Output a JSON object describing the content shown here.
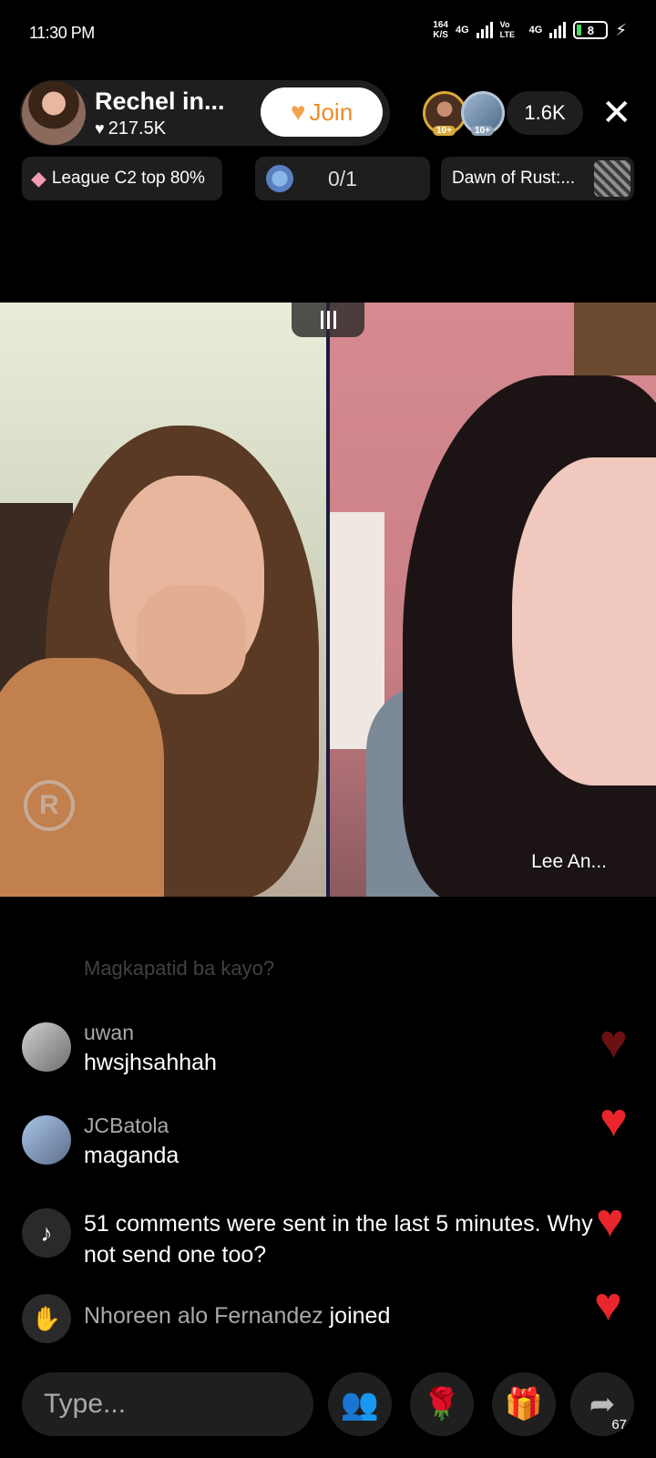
{
  "status_bar": {
    "time": "11:30 PM",
    "net_speed_value": "164",
    "net_speed_unit": "K/S",
    "network_1": "4G",
    "volte": "Vo LTE",
    "network_2": "4G",
    "battery": "8"
  },
  "host": {
    "name": "Rechel in...",
    "likes": "217.5K",
    "join_label": "Join"
  },
  "viewers": {
    "badge_1": "10+",
    "badge_2": "10+",
    "count": "1.6K"
  },
  "chips": {
    "league": "League C2 top 80%",
    "goal": "0/1",
    "game": "Dawn of Rust:..."
  },
  "video": {
    "guest_name": "Lee An..."
  },
  "chat": {
    "faded_message": "Magkapatid ba kayo?",
    "messages": [
      {
        "username": "uwan",
        "text": "hwsjhsahhah"
      },
      {
        "username": "JCBatola",
        "text": "maganda"
      }
    ],
    "system_message": "51 comments were sent in the last 5 minutes. Why not send one too?",
    "join_notice": {
      "who": "Nhoreen alo Fernandez",
      "action": "joined"
    }
  },
  "bottom_bar": {
    "input_placeholder": "Type...",
    "share_count": "67"
  },
  "colors": {
    "heart": "#e8262c",
    "join_text": "#f08a24",
    "guest_button": "#ff2e8a"
  },
  "icons": [
    "heart-icon",
    "join-heart-icon",
    "close-icon",
    "diamond-icon",
    "goal-icon",
    "tiktok-icon",
    "wave-icon",
    "guest-icon",
    "rose-icon",
    "gift-icon",
    "share-icon"
  ]
}
